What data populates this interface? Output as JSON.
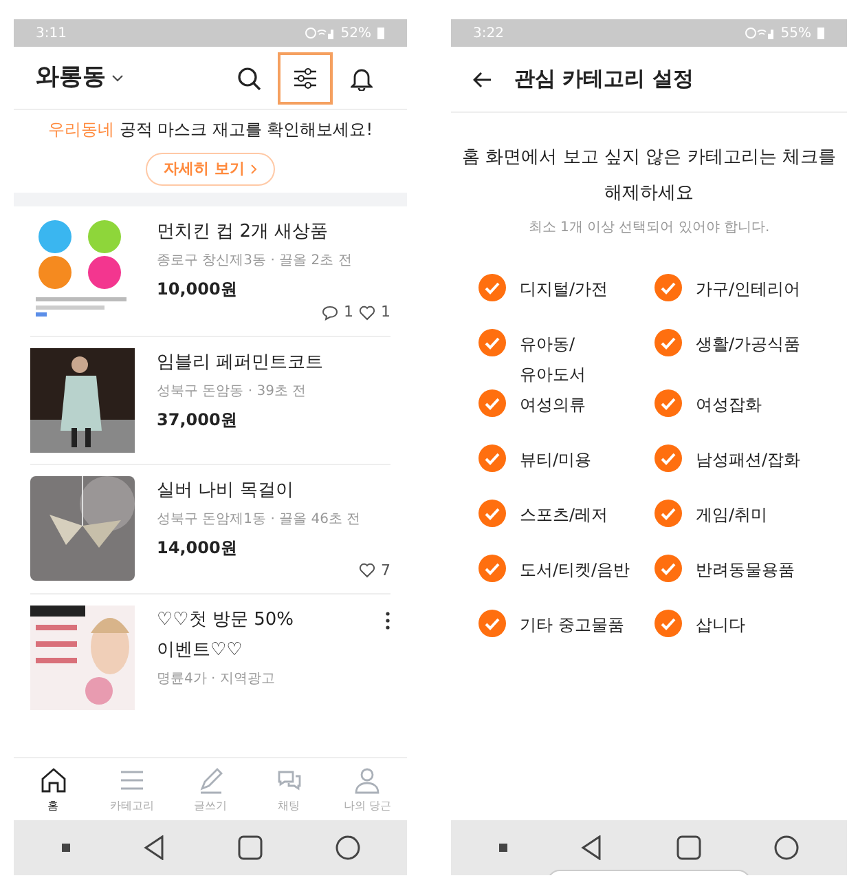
{
  "home_screen": {
    "status_bar": {
      "time": "3:11",
      "battery": "52%"
    },
    "header": {
      "location": "와롱동"
    },
    "banner": {
      "highlight": "우리동네",
      "text": "공적 마스크 재고를 확인해보세요!",
      "button": "자세히 보기"
    },
    "listings": [
      {
        "title": "먼치킨 컵 2개 새상품",
        "meta": "종로구 창신제3동 · 끌올 2초 전",
        "price": "10,000원",
        "comments": "1",
        "likes": "1"
      },
      {
        "title": "임블리 페퍼민트코트",
        "meta": "성북구 돈암동 · 39초 전",
        "price": "37,000원"
      },
      {
        "title": "실버 나비 목걸이",
        "meta": "성북구 돈암제1동 · 끌올 46초 전",
        "price": "14,000원",
        "likes": "7"
      },
      {
        "title": "♡♡첫 방문 50% 이벤트♡♡",
        "meta": "명륜4가 · 지역광고"
      }
    ],
    "tabs": [
      {
        "label": "홈",
        "selected": true
      },
      {
        "label": "카테고리",
        "selected": false
      },
      {
        "label": "글쓰기",
        "selected": false
      },
      {
        "label": "채팅",
        "selected": false
      },
      {
        "label": "나의 당근",
        "selected": false
      }
    ]
  },
  "category_screen": {
    "status_bar": {
      "time": "3:22",
      "battery": "55%"
    },
    "title": "관심 카테고리 설정",
    "instruction": "홈 화면에서 보고 싶지 않은 카테고리는 체크를 해제하세요",
    "note": "최소 1개 이상 선택되어 있어야 합니다.",
    "categories": [
      {
        "label": "디지털/가전",
        "checked": true
      },
      {
        "label": "가구/인테리어",
        "checked": true
      },
      {
        "label": "유아동/\n유아도서",
        "checked": true
      },
      {
        "label": "생활/가공식품",
        "checked": true
      },
      {
        "label": "여성의류",
        "checked": true
      },
      {
        "label": "여성잡화",
        "checked": true
      },
      {
        "label": "뷰티/미용",
        "checked": true
      },
      {
        "label": "남성패션/잡화",
        "checked": true
      },
      {
        "label": "스포츠/레저",
        "checked": true
      },
      {
        "label": "게임/취미",
        "checked": true
      },
      {
        "label": "도서/티켓/음반",
        "checked": true
      },
      {
        "label": "반려동물용품",
        "checked": true
      },
      {
        "label": "기타 중고물품",
        "checked": true
      },
      {
        "label": "삽니다",
        "checked": true
      }
    ]
  }
}
